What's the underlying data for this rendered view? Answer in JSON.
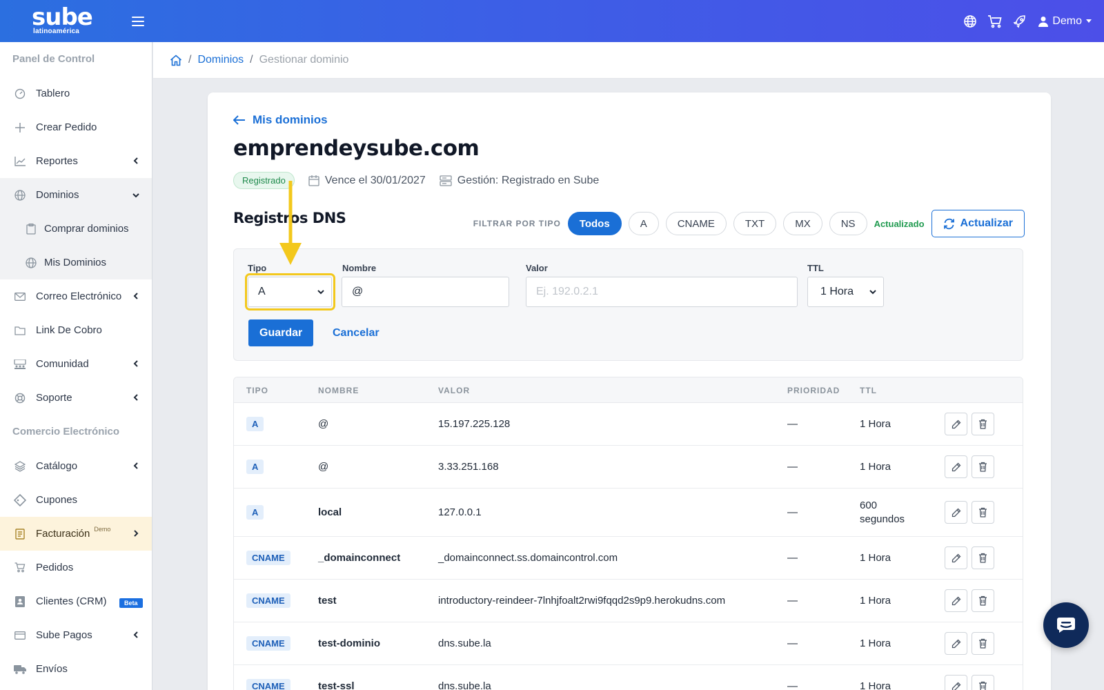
{
  "brand": {
    "logo_word": "sube",
    "logo_sub": "latinoamérica"
  },
  "topbar": {
    "user_label": "Demo"
  },
  "sidebar": {
    "section_panel": "Panel de Control",
    "section_commerce": "Comercio Electrónico",
    "items": {
      "tablero": "Tablero",
      "crear_pedido": "Crear Pedido",
      "reportes": "Reportes",
      "dominios": "Dominios",
      "comprar_dominios": "Comprar dominios",
      "mis_dominios": "Mis Dominios",
      "correo": "Correo Electrónico",
      "link_cobro": "Link De Cobro",
      "comunidad": "Comunidad",
      "soporte": "Soporte",
      "catalogo": "Catálogo",
      "cupones": "Cupones",
      "facturacion": "Facturación",
      "facturacion_sup": "Demo",
      "pedidos": "Pedidos",
      "clientes": "Clientes (CRM)",
      "clientes_badge": "Beta",
      "sube_pagos": "Sube Pagos",
      "envios": "Envíos"
    }
  },
  "breadcrumb": {
    "dominios": "Dominios",
    "current": "Gestionar dominio"
  },
  "domain": {
    "back_label": "Mis dominios",
    "name": "emprendeysube.com",
    "status": "Registrado",
    "expires": "Vence el 30/01/2027",
    "management": "Gestión: Registrado en Sube"
  },
  "dns": {
    "heading": "Registros DNS",
    "filter_label": "FILTRAR POR TIPO",
    "filters": [
      "Todos",
      "A",
      "CNAME",
      "TXT",
      "MX",
      "NS"
    ],
    "status_text": "Actualizado",
    "refresh_label": "Actualizar"
  },
  "form": {
    "tipo_label": "Tipo",
    "tipo_value": "A",
    "nombre_label": "Nombre",
    "nombre_value": "@",
    "valor_label": "Valor",
    "valor_placeholder": "Ej. 192.0.2.1",
    "ttl_label": "TTL",
    "ttl_value": "1 Hora",
    "save_label": "Guardar",
    "cancel_label": "Cancelar"
  },
  "table": {
    "headers": {
      "tipo": "TIPO",
      "nombre": "NOMBRE",
      "valor": "VALOR",
      "prioridad": "PRIORIDAD",
      "ttl": "TTL"
    },
    "rows": [
      {
        "tipo": "A",
        "nombre": "@",
        "valor": "15.197.225.128",
        "prioridad": "—",
        "ttl": "1 Hora"
      },
      {
        "tipo": "A",
        "nombre": "@",
        "valor": "3.33.251.168",
        "prioridad": "—",
        "ttl": "1 Hora"
      },
      {
        "tipo": "A",
        "nombre": "local",
        "valor": "127.0.0.1",
        "prioridad": "—",
        "ttl": "600 segundos"
      },
      {
        "tipo": "CNAME",
        "nombre": "_domainconnect",
        "valor": "_domainconnect.ss.domaincontrol.com",
        "prioridad": "—",
        "ttl": "1 Hora"
      },
      {
        "tipo": "CNAME",
        "nombre": "test",
        "valor": "introductory-reindeer-7lnhjfoalt2rwi9fqqd2s9p9.herokudns.com",
        "prioridad": "—",
        "ttl": "1 Hora"
      },
      {
        "tipo": "CNAME",
        "nombre": "test-dominio",
        "valor": "dns.sube.la",
        "prioridad": "—",
        "ttl": "1 Hora"
      },
      {
        "tipo": "CNAME",
        "nombre": "test-ssl",
        "valor": "dns.sube.la",
        "prioridad": "—",
        "ttl": "1 Hora"
      }
    ]
  },
  "colors": {
    "primary": "#1a6fd6",
    "success": "#1f9a4f",
    "highlight": "#f3c81c"
  }
}
